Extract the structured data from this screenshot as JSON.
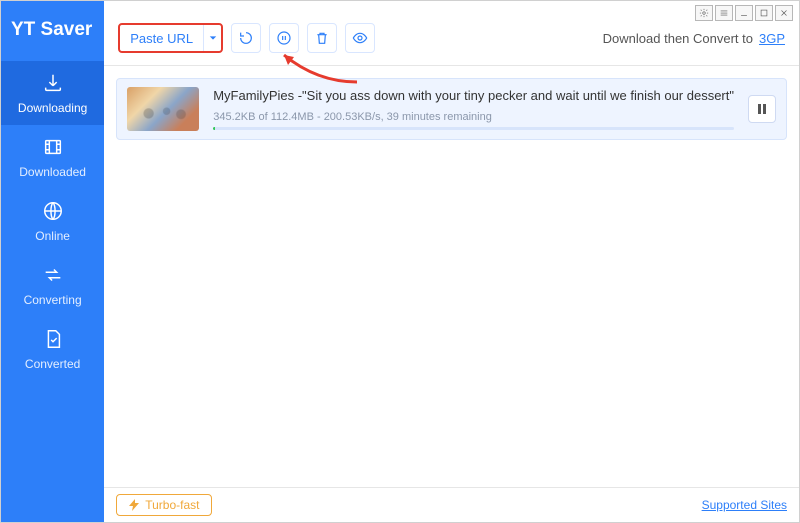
{
  "app_name": "YT Saver",
  "sidebar": {
    "items": [
      {
        "label": "Downloading",
        "active": true
      },
      {
        "label": "Downloaded",
        "active": false
      },
      {
        "label": "Online",
        "active": false
      },
      {
        "label": "Converting",
        "active": false
      },
      {
        "label": "Converted",
        "active": false
      }
    ]
  },
  "toolbar": {
    "paste_label": "Paste URL",
    "convert_prefix": "Download then Convert to",
    "convert_format": "3GP"
  },
  "downloads": [
    {
      "title": "MyFamilyPies -\"Sit you ass down with your tiny pecker and wait until we finish our dessert\"",
      "status": "345.2KB of 112.4MB - 200.53KB/s, 39 minutes remaining",
      "progress_pct": 0.3
    }
  ],
  "footer": {
    "turbo_label": "Turbo-fast",
    "supported_label": "Supported Sites"
  },
  "icons": {
    "refresh": "refresh-icon",
    "pause_all": "pause-circle-icon",
    "delete": "trash-icon",
    "preview": "eye-icon",
    "settings": "gear-icon",
    "menu": "menu-icon",
    "minimize": "minimize-icon",
    "maximize": "maximize-icon",
    "close": "close-icon"
  },
  "colors": {
    "brand": "#2d7ff9",
    "highlight_border": "#e63b2e",
    "turbo": "#f0a83a"
  }
}
